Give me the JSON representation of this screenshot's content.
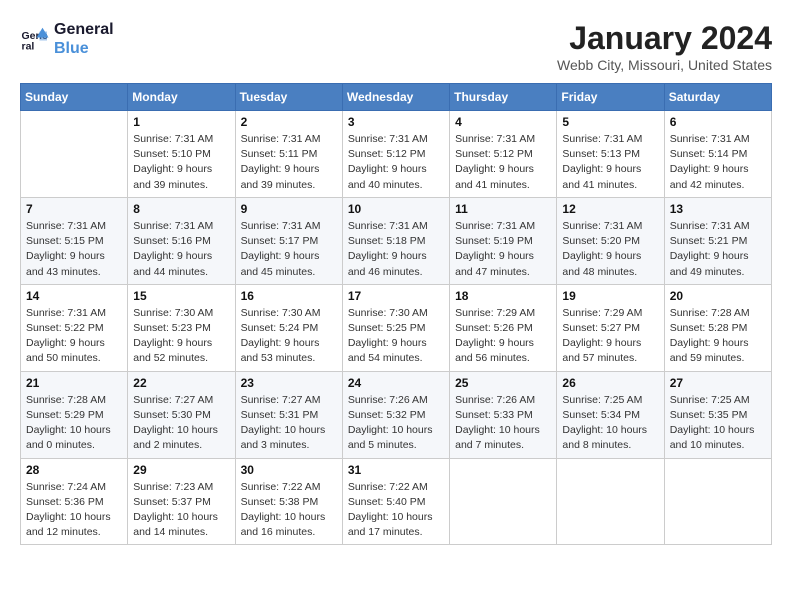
{
  "header": {
    "logo_line1": "General",
    "logo_line2": "Blue",
    "month": "January 2024",
    "location": "Webb City, Missouri, United States"
  },
  "weekdays": [
    "Sunday",
    "Monday",
    "Tuesday",
    "Wednesday",
    "Thursday",
    "Friday",
    "Saturday"
  ],
  "weeks": [
    [
      {
        "day": "",
        "sunrise": "",
        "sunset": "",
        "daylight": ""
      },
      {
        "day": "1",
        "sunrise": "Sunrise: 7:31 AM",
        "sunset": "Sunset: 5:10 PM",
        "daylight": "Daylight: 9 hours and 39 minutes."
      },
      {
        "day": "2",
        "sunrise": "Sunrise: 7:31 AM",
        "sunset": "Sunset: 5:11 PM",
        "daylight": "Daylight: 9 hours and 39 minutes."
      },
      {
        "day": "3",
        "sunrise": "Sunrise: 7:31 AM",
        "sunset": "Sunset: 5:12 PM",
        "daylight": "Daylight: 9 hours and 40 minutes."
      },
      {
        "day": "4",
        "sunrise": "Sunrise: 7:31 AM",
        "sunset": "Sunset: 5:12 PM",
        "daylight": "Daylight: 9 hours and 41 minutes."
      },
      {
        "day": "5",
        "sunrise": "Sunrise: 7:31 AM",
        "sunset": "Sunset: 5:13 PM",
        "daylight": "Daylight: 9 hours and 41 minutes."
      },
      {
        "day": "6",
        "sunrise": "Sunrise: 7:31 AM",
        "sunset": "Sunset: 5:14 PM",
        "daylight": "Daylight: 9 hours and 42 minutes."
      }
    ],
    [
      {
        "day": "7",
        "sunrise": "Sunrise: 7:31 AM",
        "sunset": "Sunset: 5:15 PM",
        "daylight": "Daylight: 9 hours and 43 minutes."
      },
      {
        "day": "8",
        "sunrise": "Sunrise: 7:31 AM",
        "sunset": "Sunset: 5:16 PM",
        "daylight": "Daylight: 9 hours and 44 minutes."
      },
      {
        "day": "9",
        "sunrise": "Sunrise: 7:31 AM",
        "sunset": "Sunset: 5:17 PM",
        "daylight": "Daylight: 9 hours and 45 minutes."
      },
      {
        "day": "10",
        "sunrise": "Sunrise: 7:31 AM",
        "sunset": "Sunset: 5:18 PM",
        "daylight": "Daylight: 9 hours and 46 minutes."
      },
      {
        "day": "11",
        "sunrise": "Sunrise: 7:31 AM",
        "sunset": "Sunset: 5:19 PM",
        "daylight": "Daylight: 9 hours and 47 minutes."
      },
      {
        "day": "12",
        "sunrise": "Sunrise: 7:31 AM",
        "sunset": "Sunset: 5:20 PM",
        "daylight": "Daylight: 9 hours and 48 minutes."
      },
      {
        "day": "13",
        "sunrise": "Sunrise: 7:31 AM",
        "sunset": "Sunset: 5:21 PM",
        "daylight": "Daylight: 9 hours and 49 minutes."
      }
    ],
    [
      {
        "day": "14",
        "sunrise": "Sunrise: 7:31 AM",
        "sunset": "Sunset: 5:22 PM",
        "daylight": "Daylight: 9 hours and 50 minutes."
      },
      {
        "day": "15",
        "sunrise": "Sunrise: 7:30 AM",
        "sunset": "Sunset: 5:23 PM",
        "daylight": "Daylight: 9 hours and 52 minutes."
      },
      {
        "day": "16",
        "sunrise": "Sunrise: 7:30 AM",
        "sunset": "Sunset: 5:24 PM",
        "daylight": "Daylight: 9 hours and 53 minutes."
      },
      {
        "day": "17",
        "sunrise": "Sunrise: 7:30 AM",
        "sunset": "Sunset: 5:25 PM",
        "daylight": "Daylight: 9 hours and 54 minutes."
      },
      {
        "day": "18",
        "sunrise": "Sunrise: 7:29 AM",
        "sunset": "Sunset: 5:26 PM",
        "daylight": "Daylight: 9 hours and 56 minutes."
      },
      {
        "day": "19",
        "sunrise": "Sunrise: 7:29 AM",
        "sunset": "Sunset: 5:27 PM",
        "daylight": "Daylight: 9 hours and 57 minutes."
      },
      {
        "day": "20",
        "sunrise": "Sunrise: 7:28 AM",
        "sunset": "Sunset: 5:28 PM",
        "daylight": "Daylight: 9 hours and 59 minutes."
      }
    ],
    [
      {
        "day": "21",
        "sunrise": "Sunrise: 7:28 AM",
        "sunset": "Sunset: 5:29 PM",
        "daylight": "Daylight: 10 hours and 0 minutes."
      },
      {
        "day": "22",
        "sunrise": "Sunrise: 7:27 AM",
        "sunset": "Sunset: 5:30 PM",
        "daylight": "Daylight: 10 hours and 2 minutes."
      },
      {
        "day": "23",
        "sunrise": "Sunrise: 7:27 AM",
        "sunset": "Sunset: 5:31 PM",
        "daylight": "Daylight: 10 hours and 3 minutes."
      },
      {
        "day": "24",
        "sunrise": "Sunrise: 7:26 AM",
        "sunset": "Sunset: 5:32 PM",
        "daylight": "Daylight: 10 hours and 5 minutes."
      },
      {
        "day": "25",
        "sunrise": "Sunrise: 7:26 AM",
        "sunset": "Sunset: 5:33 PM",
        "daylight": "Daylight: 10 hours and 7 minutes."
      },
      {
        "day": "26",
        "sunrise": "Sunrise: 7:25 AM",
        "sunset": "Sunset: 5:34 PM",
        "daylight": "Daylight: 10 hours and 8 minutes."
      },
      {
        "day": "27",
        "sunrise": "Sunrise: 7:25 AM",
        "sunset": "Sunset: 5:35 PM",
        "daylight": "Daylight: 10 hours and 10 minutes."
      }
    ],
    [
      {
        "day": "28",
        "sunrise": "Sunrise: 7:24 AM",
        "sunset": "Sunset: 5:36 PM",
        "daylight": "Daylight: 10 hours and 12 minutes."
      },
      {
        "day": "29",
        "sunrise": "Sunrise: 7:23 AM",
        "sunset": "Sunset: 5:37 PM",
        "daylight": "Daylight: 10 hours and 14 minutes."
      },
      {
        "day": "30",
        "sunrise": "Sunrise: 7:22 AM",
        "sunset": "Sunset: 5:38 PM",
        "daylight": "Daylight: 10 hours and 16 minutes."
      },
      {
        "day": "31",
        "sunrise": "Sunrise: 7:22 AM",
        "sunset": "Sunset: 5:40 PM",
        "daylight": "Daylight: 10 hours and 17 minutes."
      },
      {
        "day": "",
        "sunrise": "",
        "sunset": "",
        "daylight": ""
      },
      {
        "day": "",
        "sunrise": "",
        "sunset": "",
        "daylight": ""
      },
      {
        "day": "",
        "sunrise": "",
        "sunset": "",
        "daylight": ""
      }
    ]
  ]
}
